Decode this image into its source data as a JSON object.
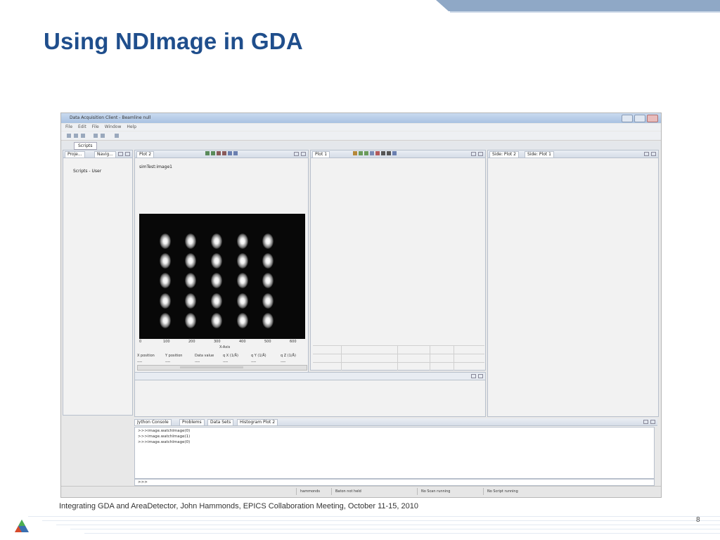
{
  "slide": {
    "title": "Using NDImage in GDA",
    "footer": "Integrating GDA and AreaDetector, John Hammonds, EPICS Collaboration Meeting, October 11-15, 2010",
    "page_number": "8",
    "colors": {
      "title": "#1f4e8c",
      "band": "#8fa8c6"
    }
  },
  "app": {
    "window_title": "Data Acquisition Client - Beamline null",
    "menu": [
      "File",
      "Edit",
      "File",
      "Window",
      "Help"
    ],
    "perspective_tab": "Scripts"
  },
  "left_panel": {
    "tabs": [
      "Proje...",
      "Navig..."
    ],
    "tree_item": "Scripts - User"
  },
  "plot2": {
    "tab": "Plot 2",
    "image_label": "simTest:image1",
    "x_ticks": [
      "0",
      "100",
      "200",
      "300",
      "400",
      "500",
      "600"
    ],
    "x_axis_label": "X-Axis",
    "columns": [
      "X position",
      "Y position",
      "Data value",
      "q X (1/Å)",
      "q Y (1/Å)",
      "q Z (1/Å)"
    ],
    "values": [
      "----",
      "----",
      "----",
      "----",
      "----",
      "----"
    ]
  },
  "plot1": {
    "tab": "Plot 1"
  },
  "side_panel": {
    "tabs": [
      "Side: Plot 2",
      "Side: Plot 1"
    ]
  },
  "console": {
    "tabs": [
      "Jython Console",
      "Problems",
      "Data Sets",
      "Histogram Plot 2"
    ],
    "lines": [
      ">>>image.watchImage(0)",
      ">>>image.watchImage(1)",
      ">>>image.watchImage(0)"
    ],
    "prompt": ">>>"
  },
  "status_bar": {
    "user": "hammonds",
    "baton": "Baton not held",
    "scan": "No Scan running",
    "script": "No Script running"
  }
}
